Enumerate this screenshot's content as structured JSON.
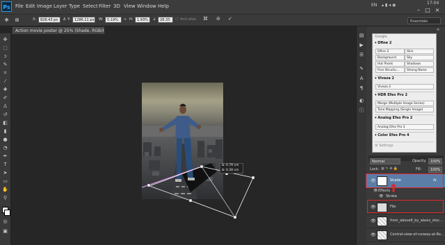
{
  "app": {
    "logo": "Ps"
  },
  "menu": [
    "File",
    "Edit",
    "Image",
    "Layer",
    "Type",
    "Select",
    "Filter",
    "3D",
    "View",
    "Window",
    "Help"
  ],
  "system": {
    "language": "EN",
    "time": "17:04"
  },
  "options": {
    "x_label": "X:",
    "x_value": "828.43 px",
    "y_label": "Y:",
    "y_value": "1286.11 px",
    "w_label": "W:",
    "w_value": "5.19%",
    "h_label": "H:",
    "h_value": "1.93%",
    "angle_value": "28.33",
    "antialias_label": "Anti-alias",
    "workspace": "Essentials"
  },
  "document": {
    "tab_title": "Action movie poster @ 25% (Shade, RGB/8) *"
  },
  "transform_readout": {
    "line1": "Δ: 0.79 cm",
    "line2": "Δ: 0.28 cm"
  },
  "nik": {
    "brand": "Google",
    "sections": [
      {
        "title": "Dfine 2",
        "buttons": [
          "Dfine 2",
          "Skin",
          "Background",
          "Sky",
          "Hot Pixels",
          "Shadows",
          "Fine Structu...",
          "Strong Noise"
        ]
      },
      {
        "title": "Viveza 2",
        "buttons": [
          "Viveza 2"
        ]
      },
      {
        "title": "HDR Efex Pro 2",
        "buttons": [
          "Merge (Multiple Image Series)",
          "Tone Mapping (Single Image)"
        ]
      },
      {
        "title": "Analog Efex Pro 2",
        "buttons": [
          "Analog Efex Pro 2"
        ]
      },
      {
        "title": "Color Efex Pro 4",
        "buttons": []
      }
    ],
    "settings": "Settings"
  },
  "layers_panel": {
    "blend_mode": "Normal",
    "opacity_label": "Opacity:",
    "opacity_value": "100%",
    "lock_label": "Lock:",
    "fill_label": "Fill:",
    "fill_value": "100%",
    "layers": [
      "Shade",
      "File",
      "from_above6_by_alexis_stoc...",
      "Central-view-of-runway-at-Ro..."
    ],
    "effects_label": "Effects",
    "stroke_label": "Stroke",
    "fx_label": "fx"
  }
}
